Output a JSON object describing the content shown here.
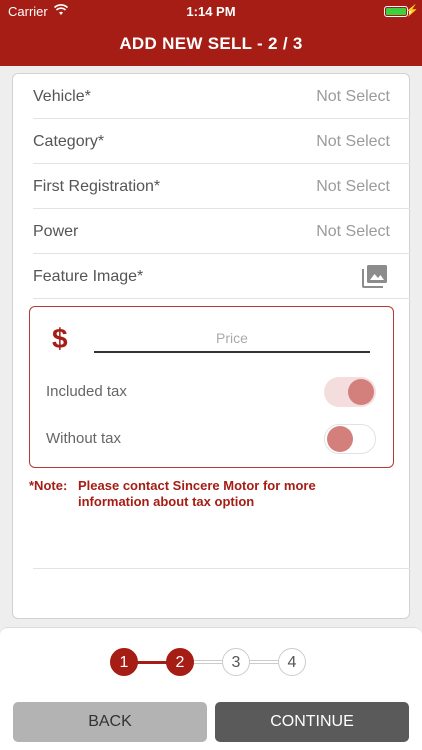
{
  "status": {
    "carrier": "Carrier",
    "time": "1:14 PM"
  },
  "nav": {
    "title": "ADD NEW SELL -  2 / 3"
  },
  "form": {
    "rows": [
      {
        "label": "Vehicle*",
        "value": "Not Select"
      },
      {
        "label": "Category*",
        "value": "Not Select"
      },
      {
        "label": "First Registration*",
        "value": "Not Select"
      },
      {
        "label": "Power",
        "value": "Not Select"
      },
      {
        "label": "Feature Image*",
        "icon": "image-gallery-icon"
      }
    ],
    "price": {
      "currency_symbol": "$",
      "placeholder": "Price",
      "value": ""
    },
    "toggles": [
      {
        "label": "Included tax",
        "state": "on"
      },
      {
        "label": "Without tax",
        "state": "off"
      }
    ],
    "note": {
      "label": "*Note:",
      "text": "Please contact Sincere Motor for more information about tax option"
    }
  },
  "steps": {
    "items": [
      {
        "label": "1",
        "state": "active"
      },
      {
        "label": "2",
        "state": "active"
      },
      {
        "label": "3",
        "state": "inactive"
      },
      {
        "label": "4",
        "state": "inactive"
      }
    ]
  },
  "buttons": {
    "back": "BACK",
    "continue": "CONTINUE"
  },
  "colors": {
    "brand": "#a51d14",
    "toggle_knob": "#d3807d",
    "continue_bg": "#5a5a5a",
    "back_bg": "#b3b3b3"
  }
}
